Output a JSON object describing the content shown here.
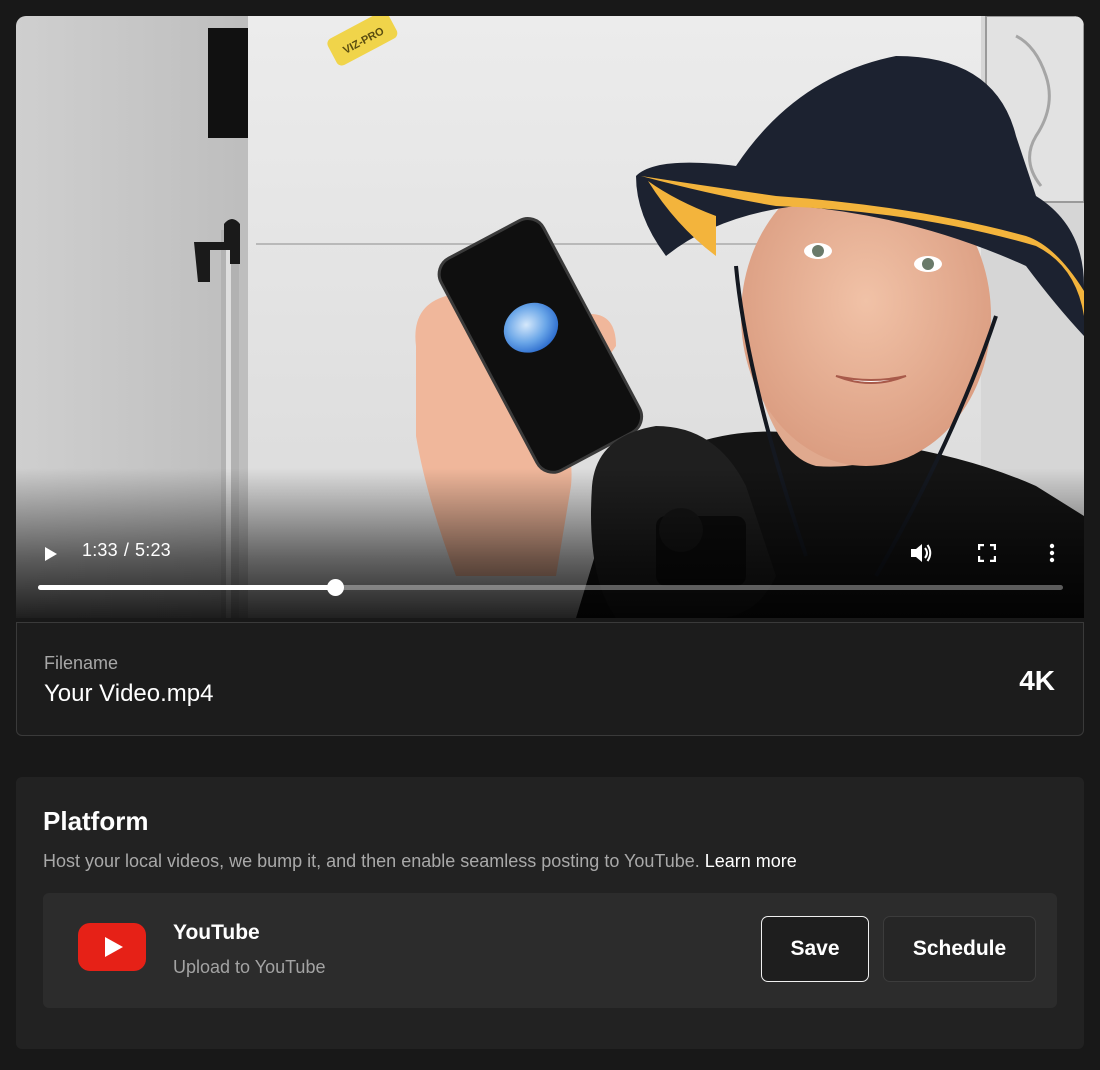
{
  "player": {
    "current_time": "1:33",
    "duration": "5:23",
    "time_separator": "/",
    "progress_fraction": 0.29,
    "buffered_fraction": 0.31,
    "icons": [
      "play-icon",
      "volume-icon",
      "fullscreen-icon",
      "more-vertical-icon"
    ]
  },
  "file": {
    "label": "Filename",
    "name": "Your Video.mp4",
    "resolution": "4K"
  },
  "platform": {
    "title": "Platform",
    "description": "Host your local videos, we bump it, and then enable seamless posting to YouTube.",
    "learn_more": "Learn more",
    "provider": {
      "name": "YouTube",
      "subtitle": "Upload to YouTube",
      "logo_icon": "youtube-logo-icon",
      "logo_color": "#e62117"
    },
    "save_label": "Save",
    "schedule_label": "Schedule"
  },
  "colors": {
    "page_bg": "#181818",
    "panel_bg": "#222222",
    "card_bg": "#2c2c2c",
    "muted_text": "#a9a9a9"
  }
}
